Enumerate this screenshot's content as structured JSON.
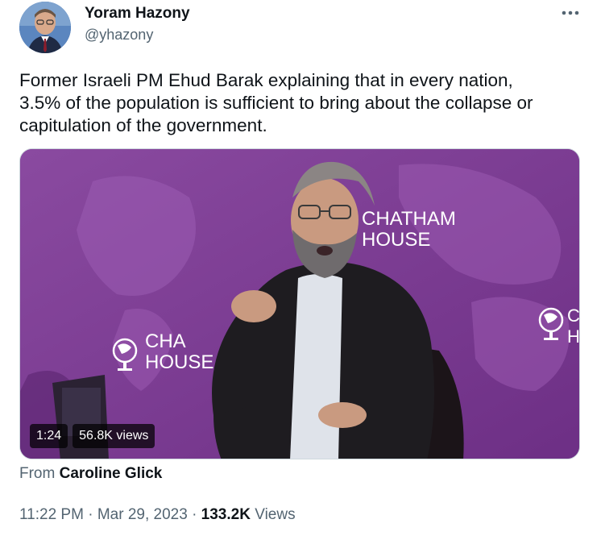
{
  "author": {
    "name": "Yoram Hazony",
    "handle": "@yhazony",
    "avatar_icon": "profile-avatar"
  },
  "more_icon": "more-options-icon",
  "tweet": {
    "text": "Former Israeli PM Ehud Barak explaining that in every nation,\n3.5% of the population is sufficient to bring about the collapse or\ncapitulation of the government."
  },
  "media": {
    "type": "video",
    "duration": "1:24",
    "views": "56.8K views",
    "logo_text_right_1": "CHATHAM",
    "logo_text_right_2": "HOUSE",
    "logo_text_left_1": "CHA",
    "logo_text_left_2": "HOUSE",
    "logo_text_far_1": "C",
    "logo_text_far_2": "H",
    "background_color": "#7d3f93"
  },
  "attribution": {
    "prefix": "From",
    "source": "Caroline Glick"
  },
  "meta": {
    "time": "11:22 PM",
    "separator": "·",
    "date": "Mar 29, 2023",
    "view_count": "133.2K",
    "views_label": "Views"
  }
}
